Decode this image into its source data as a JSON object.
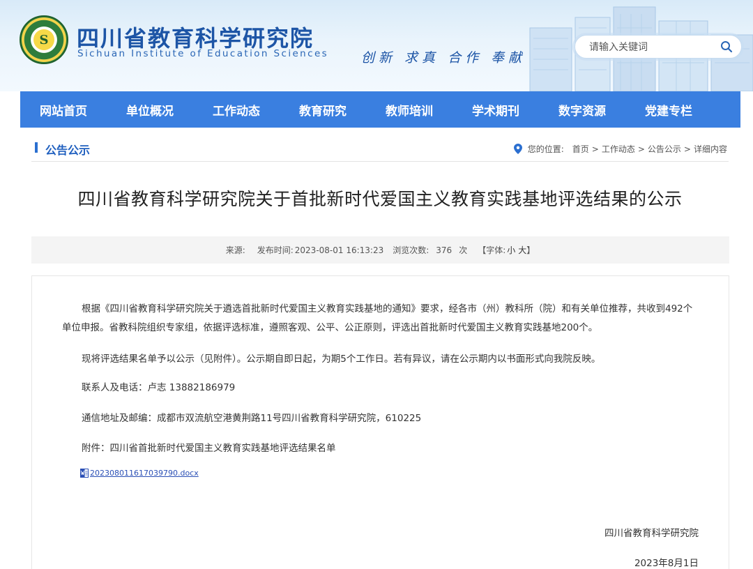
{
  "header": {
    "logo_glyph": "S",
    "title": "四川省教育科学研究院",
    "subtitle": "Sichuan Institute of Education Sciences",
    "motto": "创新 求真 合作 奉献",
    "search_placeholder": "请输入关键词",
    "accent_color": "#1d55a6"
  },
  "nav": {
    "color": "#3a7fe0",
    "items": [
      "网站首页",
      "单位概况",
      "工作动态",
      "教育研究",
      "教师培训",
      "学术期刊",
      "数字资源",
      "党建专栏"
    ]
  },
  "section": {
    "title": "公告公示",
    "location_label": "您的位置:",
    "breadcrumb": [
      "首页",
      "工作动态",
      "公告公示",
      "详细内容"
    ]
  },
  "article": {
    "title": "四川省教育科学研究院关于首批新时代爱国主义教育实践基地评选结果的公示",
    "meta": {
      "source_label": "来源:",
      "publish_label": "发布时间:",
      "publish_time": "2023-08-01 16:13:23",
      "views_label": "浏览次数:",
      "views": "376",
      "views_unit": "次",
      "font_label": "【字体:",
      "font_small": "小",
      "font_large": "大",
      "font_close": "】"
    },
    "paragraphs": [
      "根据《四川省教育科学研究院关于遴选首批新时代爱国主义教育实践基地的通知》要求，经各市（州）教科所（院）和有关单位推荐，共收到492个单位申报。省教科院组织专家组，依据评选标准，遵照客观、公平、公正原则，评选出首批新时代爱国主义教育实践基地200个。",
      "现将评选结果名单予以公示（见附件）。公示期自即日起，为期5个工作日。若有异议，请在公示期内以书面形式向我院反映。",
      "联系人及电话：卢志 13882186979",
      "通信地址及邮编：成都市双流航空港黄荆路11号四川省教育科学研究院，610225",
      "附件：四川省首批新时代爱国主义教育实践基地评选结果名单"
    ],
    "attachment_file": "202308011617039790.docx",
    "signature": "四川省教育科学研究院",
    "date": "2023年8月1日"
  }
}
